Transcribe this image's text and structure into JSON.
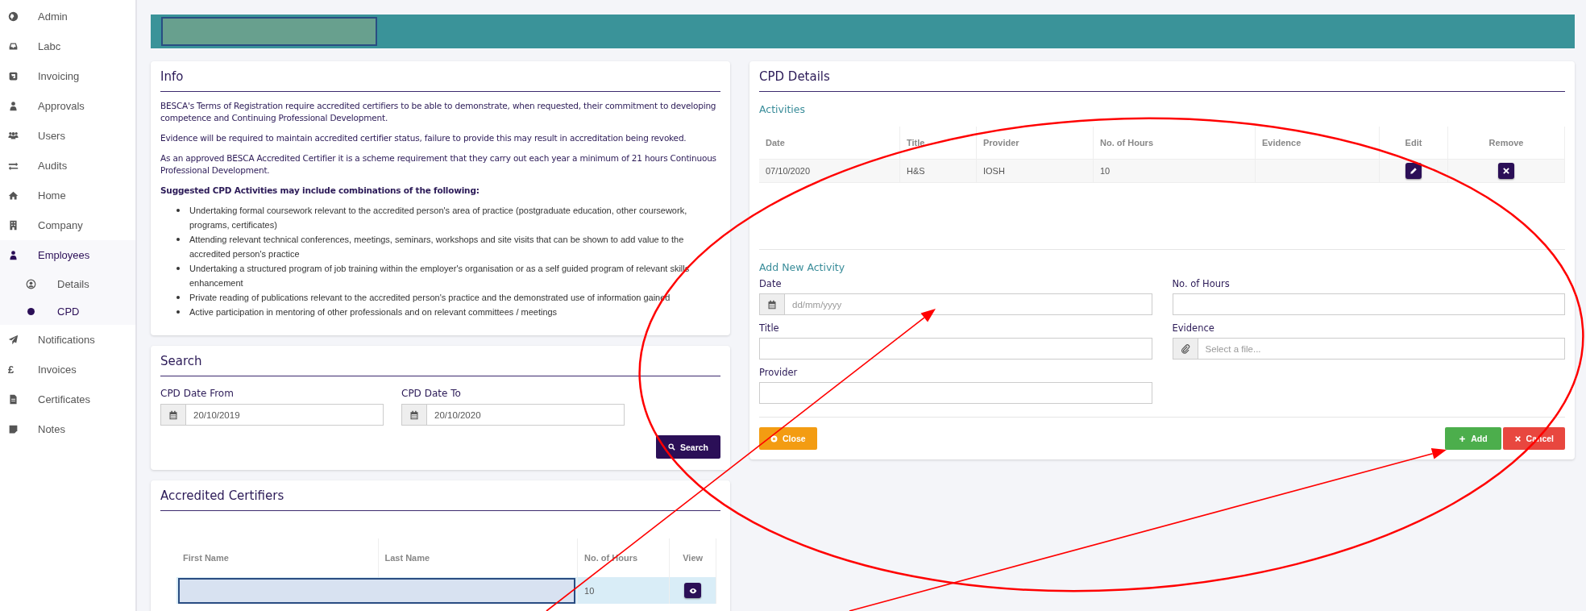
{
  "sidebar": {
    "items": [
      {
        "label": "Admin",
        "selected": false
      },
      {
        "label": "Labc",
        "selected": false
      },
      {
        "label": "Invoicing",
        "selected": false
      },
      {
        "label": "Approvals",
        "selected": false
      },
      {
        "label": "Users",
        "selected": false
      },
      {
        "label": "Audits",
        "selected": false
      },
      {
        "label": "Home",
        "selected": false
      },
      {
        "label": "Company",
        "selected": false
      },
      {
        "label": "Employees",
        "selected": true,
        "expanded": true,
        "children": [
          {
            "label": "Details",
            "selected": false
          },
          {
            "label": "CPD",
            "selected": true
          }
        ]
      },
      {
        "label": "Notifications",
        "selected": false
      },
      {
        "label": "Invoices",
        "icon_text": "£",
        "selected": false
      },
      {
        "label": "Certificates",
        "selected": false
      },
      {
        "label": "Notes",
        "selected": false
      }
    ]
  },
  "header": {
    "title_redacted": true
  },
  "info": {
    "title": "Info",
    "paragraphs": [
      "BESCA's Terms of Registration require accredited certifiers to be able to demonstrate, when requested, their commitment to developing competence and Continuing Professional Development.",
      "Evidence will be required to maintain accredited certifier status, failure to provide this may result in accreditation being revoked.",
      "As an approved BESCA Accredited Certifier it is a scheme requirement that they carry out each year a minimum of 21 hours Continuous Professional Development."
    ],
    "list_title": "Suggested CPD Activities may include combinations of the following:",
    "items": [
      "Undertaking formal coursework relevant to the accredited person's area of practice (postgraduate education, other coursework, programs, certificates)",
      "Attending relevant technical conferences, meetings, seminars, workshops and site visits that can be shown to add value to the accredited person's practice",
      "Undertaking a structured program of job training within the employer's organisation or as a self guided program of relevant skills enhancement",
      "Private reading of publications relevant to the accredited person's practice and the demonstrated use of information gained",
      "Active participation in mentoring of other professionals and on relevant committees / meetings"
    ]
  },
  "search": {
    "title": "Search",
    "fields": [
      {
        "label": "CPD Date From",
        "value": "20/10/2019"
      },
      {
        "label": "CPD Date To",
        "value": "20/10/2020"
      }
    ],
    "button": "Search"
  },
  "certifiers": {
    "title": "Accredited Certifiers",
    "columns": [
      "First Name",
      "Last Name",
      "No. of Hours",
      "View"
    ],
    "rows": [
      {
        "name_redacted": true,
        "hours": "10"
      }
    ]
  },
  "cpd": {
    "title": "CPD Details",
    "activities_title": "Activities",
    "columns": [
      "Date",
      "Title",
      "Provider",
      "No. of Hours",
      "Evidence",
      "Edit",
      "Remove"
    ],
    "rows": [
      {
        "date": "07/10/2020",
        "title": "H&S",
        "provider": "IOSH",
        "hours": "10"
      }
    ],
    "form_title": "Add New Activity",
    "fields": [
      {
        "label": "Date",
        "kind": "date",
        "placeholder": "dd/mm/yyyy"
      },
      {
        "label": "No. of Hours",
        "kind": "text"
      },
      {
        "label": "Title",
        "kind": "text"
      },
      {
        "label": "Evidence",
        "kind": "file",
        "placeholder": "Select a file..."
      },
      {
        "label": "Provider",
        "kind": "text"
      }
    ],
    "buttons": [
      {
        "label": "Close",
        "kind": "close"
      },
      {
        "label": "Add",
        "kind": "add"
      },
      {
        "label": "Cancel",
        "kind": "cancel"
      }
    ]
  },
  "annotations": [
    {
      "kind": "ellipse"
    },
    {
      "kind": "arrow"
    },
    {
      "kind": "arrow"
    }
  ]
}
